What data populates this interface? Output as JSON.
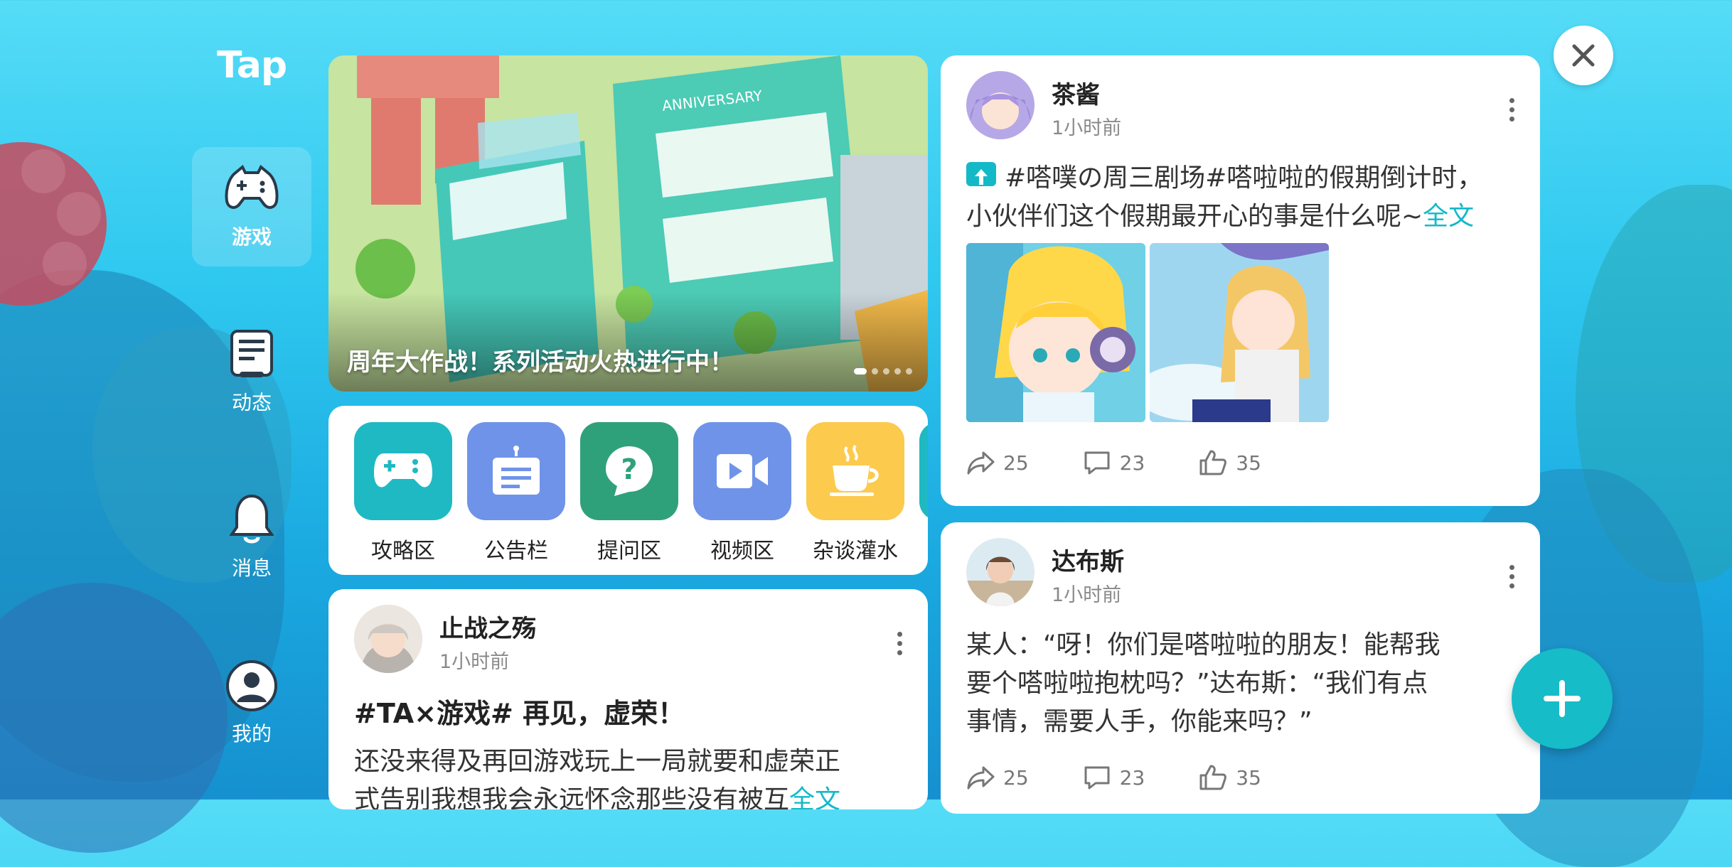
{
  "app": {
    "logo": "Tap"
  },
  "sidebar": {
    "items": [
      {
        "label": "游戏",
        "icon": "gamepad-icon",
        "active": true
      },
      {
        "label": "动态",
        "icon": "feed-icon",
        "active": false
      },
      {
        "label": "消息",
        "icon": "bell-icon",
        "active": false
      },
      {
        "label": "我的",
        "icon": "user-icon",
        "active": false
      }
    ]
  },
  "banner": {
    "caption": "周年大作战！系列活动火热进行中！",
    "sign_text": "ANNIVERSARY",
    "slides_count": 5,
    "active_slide": 1
  },
  "categories": [
    {
      "label": "攻略区",
      "icon": "gamepad-icon",
      "color": "#1fb9c3"
    },
    {
      "label": "公告栏",
      "icon": "notice-board-icon",
      "color": "#6f93e8"
    },
    {
      "label": "提问区",
      "icon": "question-bubble-icon",
      "color": "#2fa17a"
    },
    {
      "label": "视频区",
      "icon": "video-camera-icon",
      "color": "#6f93e8"
    },
    {
      "label": "杂谈灌水",
      "icon": "coffee-cup-icon",
      "color": "#fcca4c"
    }
  ],
  "posts": [
    {
      "author": "止战之殇",
      "time": "1小时前",
      "title": "#TA×游戏# 再见，虚荣！",
      "body_line1": "还没来得及再回游戏玩上一局就要和虚荣正",
      "body_line2": "式告别我想我会永远怀念那些没有被互",
      "more_link": "全文"
    },
    {
      "author": "茶酱",
      "time": "1小时前",
      "body_line1": "#嗒噗の周三剧场#嗒啦啦的假期倒计时，",
      "body_line2": "小伙伴们这个假期最开心的事是什么呢~",
      "more_link": "全文",
      "shares": "25",
      "comments": "23",
      "likes": "35"
    },
    {
      "author": "达布斯",
      "time": "1小时前",
      "body_line1": "某人：“呀！你们是嗒啦啦的朋友！能帮我",
      "body_line2": "要个嗒啦啦抱枕吗？”达布斯：“我们有点",
      "body_line3": "事情，需要人手，你能来吗？”",
      "shares": "25",
      "comments": "23",
      "likes": "35"
    }
  ],
  "colors": {
    "accent": "#14b9c8",
    "background_top": "#55dcf7",
    "background_bottom": "#1690cf"
  }
}
